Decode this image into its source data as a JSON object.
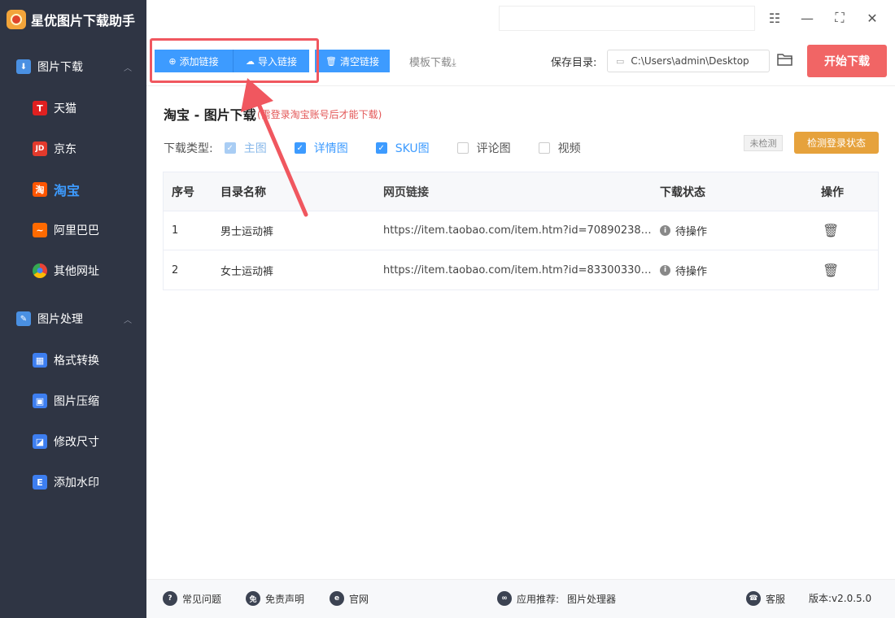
{
  "app": {
    "title": "星优图片下载助手"
  },
  "sidebar": {
    "groups": [
      {
        "label": "图片下载",
        "items": [
          {
            "label": "天猫",
            "icon": "tmall-icon",
            "icon_text": "T",
            "color": "#e02020"
          },
          {
            "label": "京东",
            "icon": "jd-icon",
            "icon_text": "JD",
            "color": "#e33a2c"
          },
          {
            "label": "淘宝",
            "icon": "taobao-icon",
            "icon_text": "淘",
            "color": "#ff5500",
            "active": true
          },
          {
            "label": "阿里巴巴",
            "icon": "alibaba-icon",
            "icon_text": "~",
            "color": "#ff6a00"
          },
          {
            "label": "其他网址",
            "icon": "chrome-icon",
            "icon_text": "●",
            "color": "#4caf50"
          }
        ]
      },
      {
        "label": "图片处理",
        "items": [
          {
            "label": "格式转换",
            "icon": "format-convert-icon",
            "icon_text": "",
            "color": "#3d7ef0"
          },
          {
            "label": "图片压缩",
            "icon": "compress-icon",
            "icon_text": "",
            "color": "#3d7ef0"
          },
          {
            "label": "修改尺寸",
            "icon": "resize-icon",
            "icon_text": "",
            "color": "#3d7ef0"
          },
          {
            "label": "添加水印",
            "icon": "watermark-icon",
            "icon_text": "",
            "color": "#3d7ef0"
          }
        ]
      }
    ]
  },
  "toolbar": {
    "add_link": "添加链接",
    "import_link": "导入链接",
    "clear_link": "清空链接",
    "template_download": "模板下载⤓",
    "save_dir_label": "保存目录:",
    "save_dir_value": "C:\\Users\\admin\\Desktop",
    "start_download": "开始下载"
  },
  "main": {
    "title": "淘宝 - 图片下载",
    "note": "(需登录淘宝账号后才能下载)",
    "type_label": "下载类型:",
    "types": [
      {
        "label": "主图",
        "state": "disabled"
      },
      {
        "label": "详情图",
        "state": "checked"
      },
      {
        "label": "SKU图",
        "state": "checked"
      },
      {
        "label": "评论图",
        "state": "unchecked"
      },
      {
        "label": "视频",
        "state": "unchecked"
      }
    ],
    "login_status": "未检测",
    "check_login": "检测登录状态"
  },
  "table": {
    "headers": [
      "序号",
      "目录名称",
      "网页链接",
      "下载状态",
      "操作"
    ],
    "rows": [
      {
        "index": "1",
        "name": "男士运动裤",
        "url": "https://item.taobao.com/item.htm?id=708902385...",
        "status": "待操作"
      },
      {
        "index": "2",
        "name": "女士运动裤",
        "url": "https://item.taobao.com/item.htm?id=833003305...",
        "status": "待操作"
      }
    ]
  },
  "footer": {
    "faq": "常见问题",
    "disclaimer": "免责声明",
    "website": "官网",
    "recommend_label": "应用推荐:",
    "recommend_app": "图片处理器",
    "support": "客服",
    "version": "版本:v2.0.5.0"
  },
  "colors": {
    "sidebar_bg": "#2f3544",
    "primary": "#3d9bff",
    "start_button": "#f16565",
    "check_button": "#e6a23c",
    "highlight": "#f0575f",
    "note": "#e35757"
  }
}
